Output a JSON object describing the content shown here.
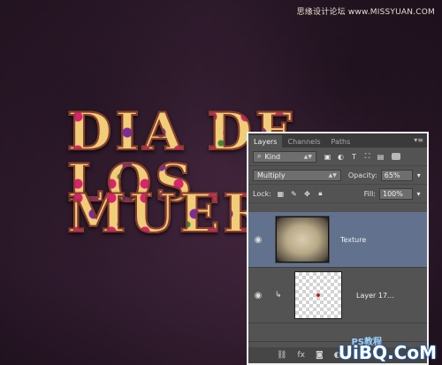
{
  "watermark_top": "思缘设计论坛 www.MISSYUAN.COM",
  "canvas": {
    "title_line1": "DIA DE LOS",
    "title_line2": "MUERT"
  },
  "layers_panel": {
    "tabs": [
      "Layers",
      "Channels",
      "Paths"
    ],
    "active_tab": "Layers",
    "filter_kind": "Kind",
    "blend_mode": "Multiply",
    "opacity_label": "Opacity:",
    "opacity_value": "65%",
    "lock_label": "Lock:",
    "fill_label": "Fill:",
    "fill_value": "100%",
    "layers": [
      {
        "name": "Texture",
        "selected": true,
        "visible": true
      },
      {
        "name": "Layer 17...",
        "selected": false,
        "visible": true,
        "clipped": true
      }
    ]
  },
  "watermark_bottom": "UiBQ.CoM",
  "watermark_ps": "PS教程"
}
